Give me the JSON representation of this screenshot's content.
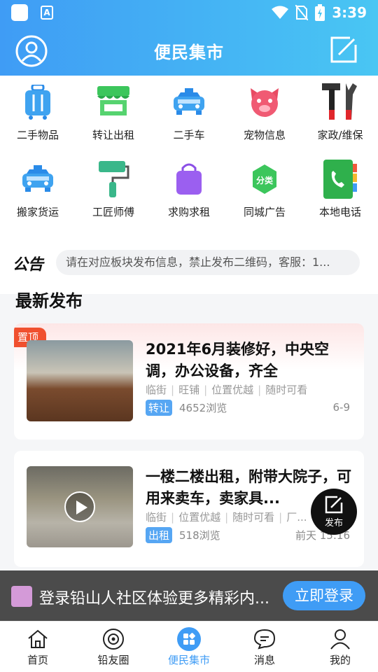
{
  "status_bar": {
    "time": "3:39",
    "a_icon": "A"
  },
  "header": {
    "title": "便民集市"
  },
  "categories": [
    {
      "label": "二手物品",
      "icon": "luggage-icon"
    },
    {
      "label": "转让出租",
      "icon": "shop-stall-icon"
    },
    {
      "label": "二手车",
      "icon": "car-icon"
    },
    {
      "label": "宠物信息",
      "icon": "pig-icon"
    },
    {
      "label": "家政/维保",
      "icon": "tools-icon"
    },
    {
      "label": "搬家货运",
      "icon": "van-icon"
    },
    {
      "label": "工匠师傅",
      "icon": "paint-roller-icon"
    },
    {
      "label": "求购求租",
      "icon": "shopping-bag-icon"
    },
    {
      "label": "同城广告",
      "icon": "ad-icon"
    },
    {
      "label": "本地电话",
      "icon": "phone-book-icon"
    }
  ],
  "notice": {
    "tag": "公告",
    "text": "请在对应板块发布信息，禁止发布二维码，客服：1..."
  },
  "section_title": "最新发布",
  "posts": [
    {
      "pinned_label": "置顶",
      "title": "2021年6月装修好，中央空调，办公设备，齐全",
      "tags": [
        "临街",
        "旺铺",
        "位置优越",
        "随时可看"
      ],
      "badge": "转让",
      "views": "4652浏览",
      "date": "6-9"
    },
    {
      "title": "一楼二楼出租，附带大院子，可用来卖车，卖家具...",
      "tags": [
        "临街",
        "位置优越",
        "随时可看",
        "厂..."
      ],
      "badge": "出租",
      "views": "518浏览",
      "date": "前天 15:16"
    }
  ],
  "fab": {
    "label": "发布"
  },
  "login_banner": {
    "text": "登录铅山人社区体验更多精彩内...",
    "button": "立即登录"
  },
  "bottom_nav": [
    {
      "label": "首页",
      "icon": "home-icon"
    },
    {
      "label": "铅友圈",
      "icon": "circle-icon"
    },
    {
      "label": "便民集市",
      "icon": "grid-icon",
      "active": true
    },
    {
      "label": "消息",
      "icon": "message-icon"
    },
    {
      "label": "我的",
      "icon": "user-icon"
    }
  ],
  "colors": {
    "accent": "#3f9cf5",
    "pin": "#f0502f",
    "badge": "#56a6f3"
  }
}
